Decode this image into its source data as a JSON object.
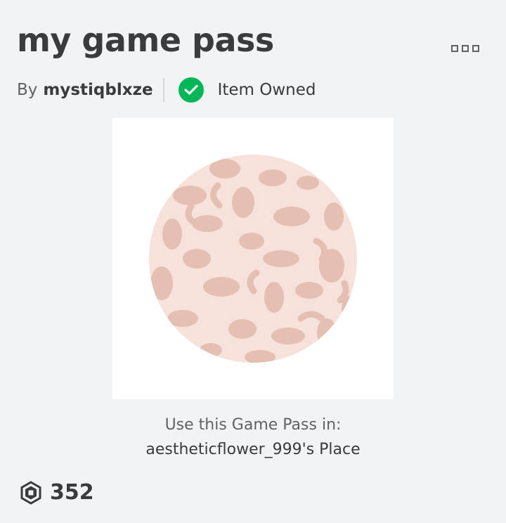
{
  "item": {
    "title": "my game pass",
    "by_prefix": "By",
    "creator": "mystiqblxze",
    "ownership_status": "Item Owned"
  },
  "icons": {
    "more": "more-options-icon",
    "owned": "checkmark-icon",
    "currency": "robux-icon"
  },
  "usage": {
    "label": "Use this Game Pass in:",
    "place_name": "aestheticflower_999's Place"
  },
  "price": {
    "value": "352"
  },
  "colors": {
    "owned_badge": "#02b757",
    "text_primary": "#393b3d",
    "text_secondary": "#606264",
    "background": "#f2f3f5"
  }
}
